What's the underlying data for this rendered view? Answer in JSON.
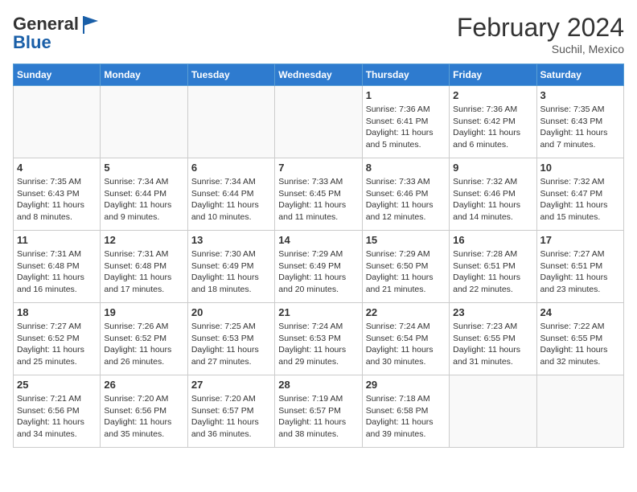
{
  "header": {
    "logo_general": "General",
    "logo_blue": "Blue",
    "month_year": "February 2024",
    "location": "Suchil, Mexico"
  },
  "weekdays": [
    "Sunday",
    "Monday",
    "Tuesday",
    "Wednesday",
    "Thursday",
    "Friday",
    "Saturday"
  ],
  "weeks": [
    [
      {
        "day": "",
        "info": ""
      },
      {
        "day": "",
        "info": ""
      },
      {
        "day": "",
        "info": ""
      },
      {
        "day": "",
        "info": ""
      },
      {
        "day": "1",
        "info": "Sunrise: 7:36 AM\nSunset: 6:41 PM\nDaylight: 11 hours and 5 minutes."
      },
      {
        "day": "2",
        "info": "Sunrise: 7:36 AM\nSunset: 6:42 PM\nDaylight: 11 hours and 6 minutes."
      },
      {
        "day": "3",
        "info": "Sunrise: 7:35 AM\nSunset: 6:43 PM\nDaylight: 11 hours and 7 minutes."
      }
    ],
    [
      {
        "day": "4",
        "info": "Sunrise: 7:35 AM\nSunset: 6:43 PM\nDaylight: 11 hours and 8 minutes."
      },
      {
        "day": "5",
        "info": "Sunrise: 7:34 AM\nSunset: 6:44 PM\nDaylight: 11 hours and 9 minutes."
      },
      {
        "day": "6",
        "info": "Sunrise: 7:34 AM\nSunset: 6:44 PM\nDaylight: 11 hours and 10 minutes."
      },
      {
        "day": "7",
        "info": "Sunrise: 7:33 AM\nSunset: 6:45 PM\nDaylight: 11 hours and 11 minutes."
      },
      {
        "day": "8",
        "info": "Sunrise: 7:33 AM\nSunset: 6:46 PM\nDaylight: 11 hours and 12 minutes."
      },
      {
        "day": "9",
        "info": "Sunrise: 7:32 AM\nSunset: 6:46 PM\nDaylight: 11 hours and 14 minutes."
      },
      {
        "day": "10",
        "info": "Sunrise: 7:32 AM\nSunset: 6:47 PM\nDaylight: 11 hours and 15 minutes."
      }
    ],
    [
      {
        "day": "11",
        "info": "Sunrise: 7:31 AM\nSunset: 6:48 PM\nDaylight: 11 hours and 16 minutes."
      },
      {
        "day": "12",
        "info": "Sunrise: 7:31 AM\nSunset: 6:48 PM\nDaylight: 11 hours and 17 minutes."
      },
      {
        "day": "13",
        "info": "Sunrise: 7:30 AM\nSunset: 6:49 PM\nDaylight: 11 hours and 18 minutes."
      },
      {
        "day": "14",
        "info": "Sunrise: 7:29 AM\nSunset: 6:49 PM\nDaylight: 11 hours and 20 minutes."
      },
      {
        "day": "15",
        "info": "Sunrise: 7:29 AM\nSunset: 6:50 PM\nDaylight: 11 hours and 21 minutes."
      },
      {
        "day": "16",
        "info": "Sunrise: 7:28 AM\nSunset: 6:51 PM\nDaylight: 11 hours and 22 minutes."
      },
      {
        "day": "17",
        "info": "Sunrise: 7:27 AM\nSunset: 6:51 PM\nDaylight: 11 hours and 23 minutes."
      }
    ],
    [
      {
        "day": "18",
        "info": "Sunrise: 7:27 AM\nSunset: 6:52 PM\nDaylight: 11 hours and 25 minutes."
      },
      {
        "day": "19",
        "info": "Sunrise: 7:26 AM\nSunset: 6:52 PM\nDaylight: 11 hours and 26 minutes."
      },
      {
        "day": "20",
        "info": "Sunrise: 7:25 AM\nSunset: 6:53 PM\nDaylight: 11 hours and 27 minutes."
      },
      {
        "day": "21",
        "info": "Sunrise: 7:24 AM\nSunset: 6:53 PM\nDaylight: 11 hours and 29 minutes."
      },
      {
        "day": "22",
        "info": "Sunrise: 7:24 AM\nSunset: 6:54 PM\nDaylight: 11 hours and 30 minutes."
      },
      {
        "day": "23",
        "info": "Sunrise: 7:23 AM\nSunset: 6:55 PM\nDaylight: 11 hours and 31 minutes."
      },
      {
        "day": "24",
        "info": "Sunrise: 7:22 AM\nSunset: 6:55 PM\nDaylight: 11 hours and 32 minutes."
      }
    ],
    [
      {
        "day": "25",
        "info": "Sunrise: 7:21 AM\nSunset: 6:56 PM\nDaylight: 11 hours and 34 minutes."
      },
      {
        "day": "26",
        "info": "Sunrise: 7:20 AM\nSunset: 6:56 PM\nDaylight: 11 hours and 35 minutes."
      },
      {
        "day": "27",
        "info": "Sunrise: 7:20 AM\nSunset: 6:57 PM\nDaylight: 11 hours and 36 minutes."
      },
      {
        "day": "28",
        "info": "Sunrise: 7:19 AM\nSunset: 6:57 PM\nDaylight: 11 hours and 38 minutes."
      },
      {
        "day": "29",
        "info": "Sunrise: 7:18 AM\nSunset: 6:58 PM\nDaylight: 11 hours and 39 minutes."
      },
      {
        "day": "",
        "info": ""
      },
      {
        "day": "",
        "info": ""
      }
    ]
  ]
}
